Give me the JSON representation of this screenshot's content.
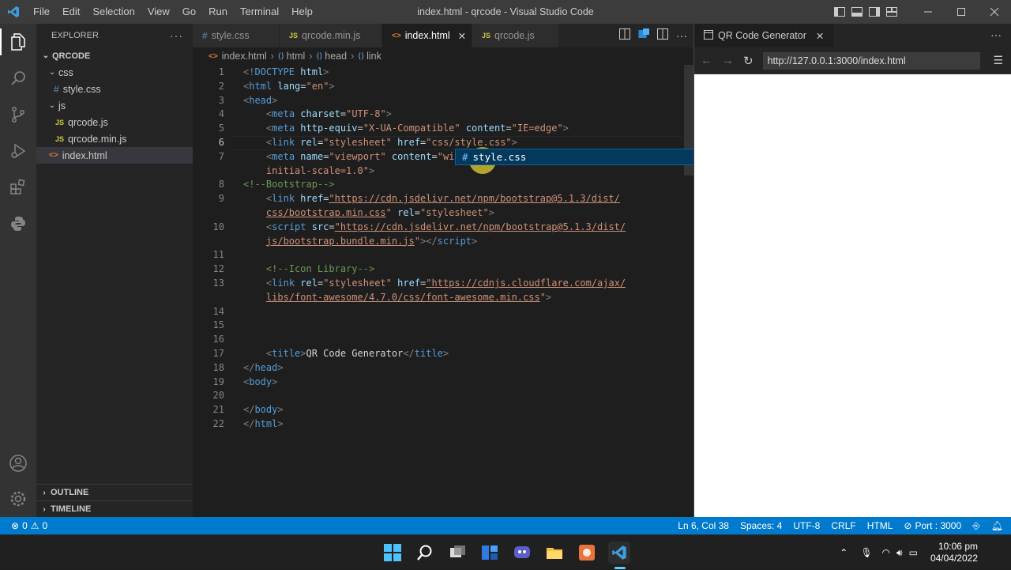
{
  "window": {
    "title": "index.html - qrcode - Visual Studio Code"
  },
  "menu": [
    "File",
    "Edit",
    "Selection",
    "View",
    "Go",
    "Run",
    "Terminal",
    "Help"
  ],
  "explorer": {
    "title": "EXPLORER",
    "root": "QRCODE",
    "items": [
      {
        "label": "css",
        "type": "folder"
      },
      {
        "label": "style.css",
        "type": "css"
      },
      {
        "label": "js",
        "type": "folder"
      },
      {
        "label": "qrcode.js",
        "type": "js"
      },
      {
        "label": "qrcode.min.js",
        "type": "js"
      },
      {
        "label": "index.html",
        "type": "html",
        "selected": true
      }
    ],
    "outline": "OUTLINE",
    "timeline": "TIMELINE"
  },
  "tabs": [
    {
      "label": "style.css",
      "icon": "#"
    },
    {
      "label": "qrcode.min.js",
      "icon": "JS"
    },
    {
      "label": "index.html",
      "icon": "<>",
      "active": true
    },
    {
      "label": "qrcode.js",
      "icon": "JS"
    }
  ],
  "breadcrumb": [
    "index.html",
    "html",
    "head",
    "link"
  ],
  "code": {
    "lines": [
      {
        "n": "1",
        "html": "<span class='tb'>&lt;!</span><span class='t'>DOCTYPE</span> <span class='a'>html</span><span class='tb'>&gt;</span>"
      },
      {
        "n": "2",
        "html": "<span class='tb'>&lt;</span><span class='t'>html</span> <span class='a'>lang</span><span class='tx'>=</span><span class='s'>\"en\"</span><span class='tb'>&gt;</span>"
      },
      {
        "n": "3",
        "html": "<span class='tb'>&lt;</span><span class='t'>head</span><span class='tb'>&gt;</span>"
      },
      {
        "n": "4",
        "html": "    <span class='tb'>&lt;</span><span class='t'>meta</span> <span class='a'>charset</span><span class='tx'>=</span><span class='s'>\"UTF-8\"</span><span class='tb'>&gt;</span>"
      },
      {
        "n": "5",
        "html": "    <span class='tb'>&lt;</span><span class='t'>meta</span> <span class='a'>http-equiv</span><span class='tx'>=</span><span class='s'>\"X-UA-Compatible\"</span> <span class='a'>content</span><span class='tx'>=</span><span class='s'>\"IE=edge\"</span><span class='tb'>&gt;</span>"
      },
      {
        "n": "6",
        "html": "    <span class='tb'>&lt;</span><span class='t'>link</span> <span class='a'>rel</span><span class='tx'>=</span><span class='s'>\"stylesheet\"</span> <span class='a'>href</span><span class='tx'>=</span><span class='s'>\"css/style.css\"</span><span class='tb'>&gt;</span>",
        "current": true
      },
      {
        "n": "7",
        "html": "    <span class='tb'>&lt;</span><span class='t'>meta</span> <span class='a'>name</span><span class='tx'>=</span><span class='s'>\"viewport\"</span> <span class='a'>content</span><span class='tx'>=</span><span class='s'>\"wi</span>"
      },
      {
        "n": "",
        "html": "    <span class='s'>initial-scale=1.0\"</span><span class='tb'>&gt;</span>"
      },
      {
        "n": "8",
        "html": "<span class='c'>&lt;!--Bootstrap--&gt;</span>"
      },
      {
        "n": "9",
        "html": "    <span class='tb'>&lt;</span><span class='t'>link</span> <span class='a'>href</span><span class='tx'>=</span><span class='s u'>\"https://cdn.jsdelivr.net/npm/bootstrap@5.1.3/dist/</span>"
      },
      {
        "n": "",
        "html": "    <span class='s u'>css/bootstrap.min.css</span><span class='s'>\"</span> <span class='a'>rel</span><span class='tx'>=</span><span class='s'>\"stylesheet\"</span><span class='tb'>&gt;</span>"
      },
      {
        "n": "10",
        "html": "    <span class='tb'>&lt;</span><span class='t'>script</span> <span class='a'>src</span><span class='tx'>=</span><span class='s u'>\"https://cdn.jsdelivr.net/npm/bootstrap@5.1.3/dist/</span>"
      },
      {
        "n": "",
        "html": "    <span class='s u'>js/bootstrap.bundle.min.js</span><span class='s'>\"</span><span class='tb'>&gt;&lt;/</span><span class='t'>script</span><span class='tb'>&gt;</span>"
      },
      {
        "n": "11",
        "html": ""
      },
      {
        "n": "12",
        "html": "    <span class='c'>&lt;!--Icon Library--&gt;</span>"
      },
      {
        "n": "13",
        "html": "    <span class='tb'>&lt;</span><span class='t'>link</span> <span class='a'>rel</span><span class='tx'>=</span><span class='s'>\"stylesheet\"</span> <span class='a'>href</span><span class='tx'>=</span><span class='s u'>\"https://cdnjs.cloudflare.com/ajax/</span>"
      },
      {
        "n": "",
        "html": "    <span class='s u'>libs/font-awesome/4.7.0/css/font-awesome.min.css</span><span class='s'>\"</span><span class='tb'>&gt;</span>"
      },
      {
        "n": "14",
        "html": ""
      },
      {
        "n": "15",
        "html": ""
      },
      {
        "n": "16",
        "html": ""
      },
      {
        "n": "17",
        "html": "    <span class='tb'>&lt;</span><span class='t'>title</span><span class='tb'>&gt;</span><span class='tx'>QR Code Generator</span><span class='tb'>&lt;/</span><span class='t'>title</span><span class='tb'>&gt;</span>"
      },
      {
        "n": "18",
        "html": "<span class='tb'>&lt;/</span><span class='t'>head</span><span class='tb'>&gt;</span>"
      },
      {
        "n": "19",
        "html": "<span class='tb'>&lt;</span><span class='t'>body</span><span class='tb'>&gt;</span>"
      },
      {
        "n": "20",
        "html": ""
      },
      {
        "n": "21",
        "html": "<span class='tb'>&lt;/</span><span class='t'>body</span><span class='tb'>&gt;</span>"
      },
      {
        "n": "22",
        "html": "<span class='tb'>&lt;/</span><span class='t'>html</span><span class='tb'>&gt;</span>"
      }
    ]
  },
  "suggestion": {
    "icon": "#",
    "label": "style.css"
  },
  "preview": {
    "tab": "QR Code Generator",
    "url": "http://127.0.0.1:3000/index.html"
  },
  "status": {
    "problems": "0",
    "warnings": "0",
    "position": "Ln 6, Col 38",
    "spaces": "Spaces: 4",
    "encoding": "UTF-8",
    "eol": "CRLF",
    "language": "HTML",
    "port": "Port : 3000"
  },
  "taskbar": {
    "time": "10:06 pm",
    "date": "04/04/2022"
  }
}
